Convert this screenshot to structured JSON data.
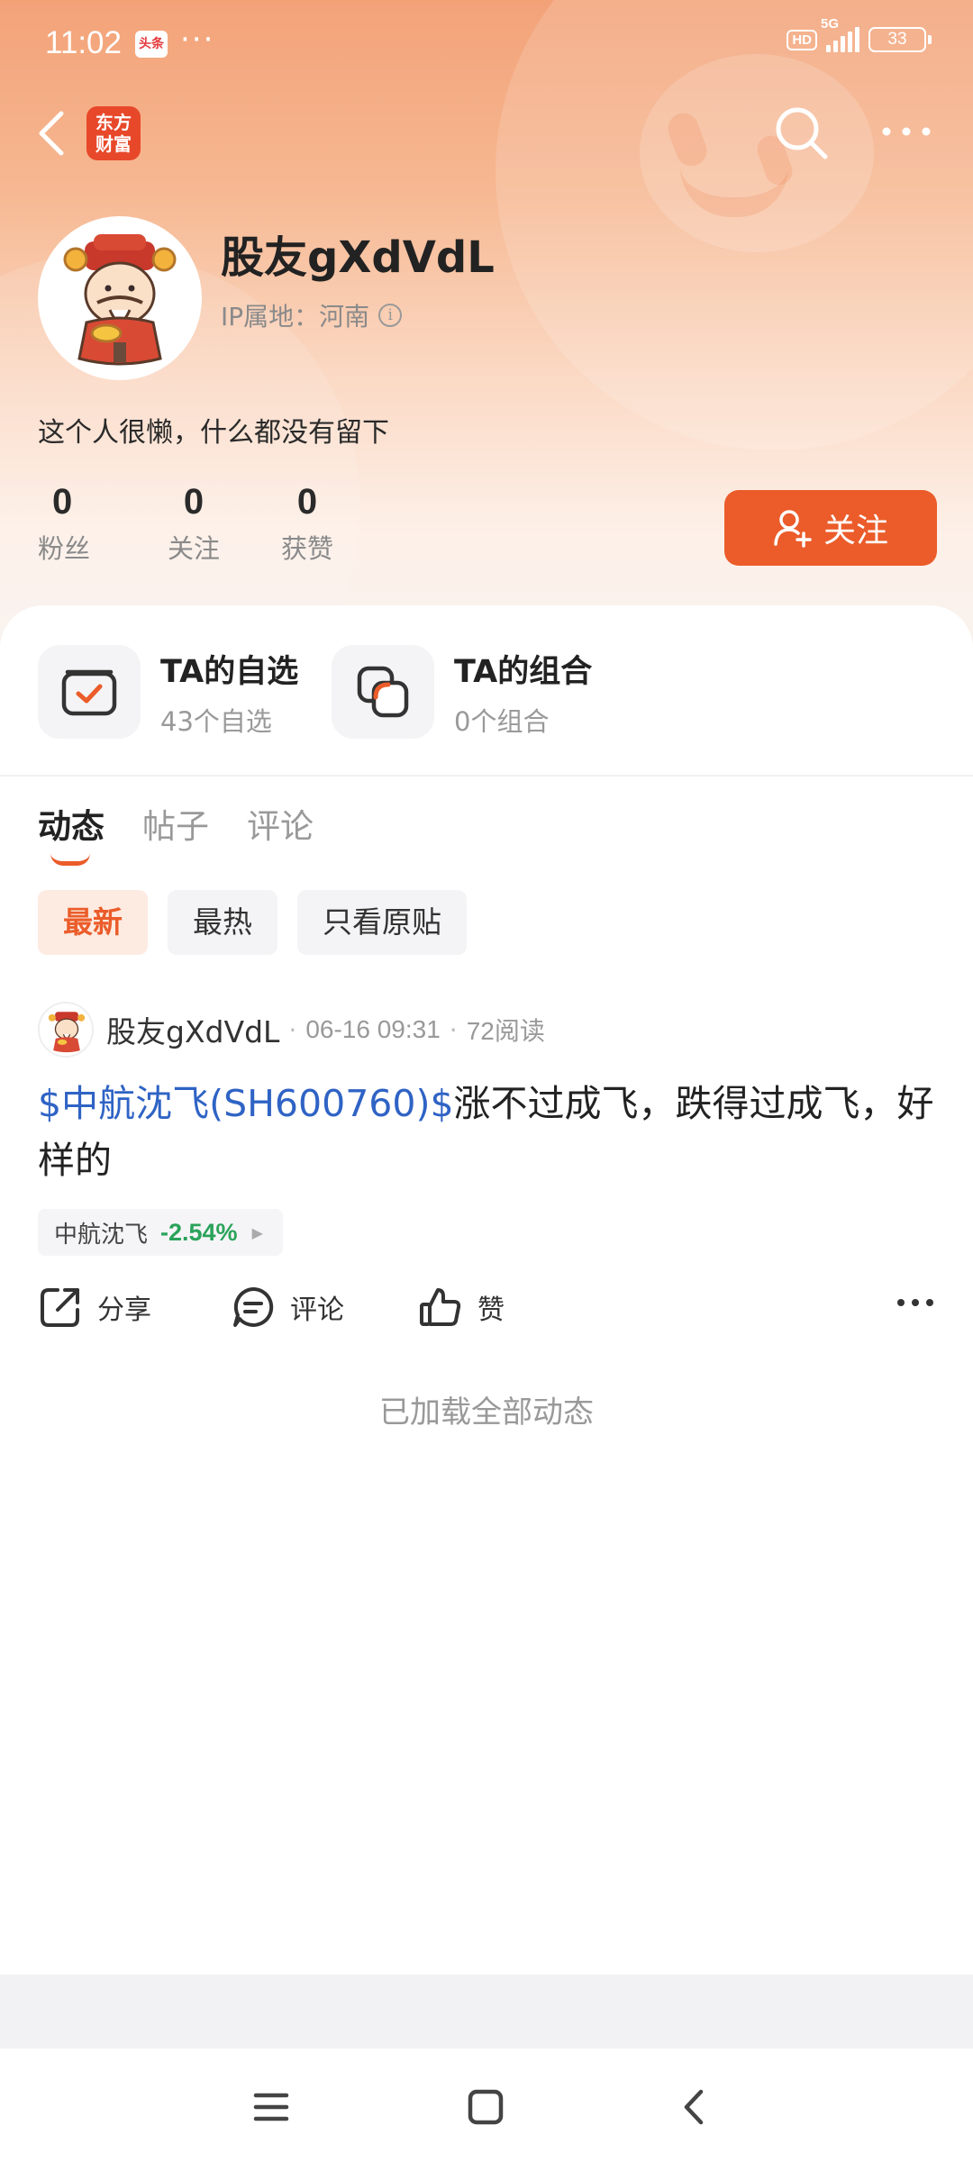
{
  "status_bar": {
    "time": "11:02",
    "app_icon_text": "头条",
    "dots": "···",
    "hd": "HD",
    "network": "5G",
    "battery": "33"
  },
  "nav": {
    "logo_line1": "东方",
    "logo_line2": "财富"
  },
  "profile": {
    "username": "股友gXdVdL",
    "ip_location": "IP属地：河南",
    "bio": "这个人很懒，什么都没有留下",
    "stats": [
      {
        "value": "0",
        "label": "粉丝"
      },
      {
        "value": "0",
        "label": "关注"
      },
      {
        "value": "0",
        "label": "获赞"
      }
    ],
    "follow_label": "关注"
  },
  "quick_links": [
    {
      "title": "TA的自选",
      "subtitle": "43个自选"
    },
    {
      "title": "TA的组合",
      "subtitle": "0个组合"
    }
  ],
  "tabs": [
    {
      "label": "动态",
      "active": true
    },
    {
      "label": "帖子",
      "active": false
    },
    {
      "label": "评论",
      "active": false
    }
  ],
  "filters": [
    {
      "label": "最新",
      "active": true
    },
    {
      "label": "最热",
      "active": false
    },
    {
      "label": "只看原贴",
      "active": false
    }
  ],
  "post": {
    "author": "股友gXdVdL",
    "date": "06-16 09:31",
    "reads": "72阅读",
    "stock_link": "$中航沈飞(SH600760)$",
    "text": "涨不过成飞，跌得过成飞，好样的",
    "stock_tag": {
      "name": "中航沈飞",
      "change": "-2.54%"
    },
    "actions": {
      "share": "分享",
      "comment": "评论",
      "like": "赞"
    }
  },
  "footer_text": "已加载全部动态",
  "colors": {
    "accent": "#eb5c2a",
    "link": "#2f63c5",
    "down_green": "#2aa35a"
  }
}
